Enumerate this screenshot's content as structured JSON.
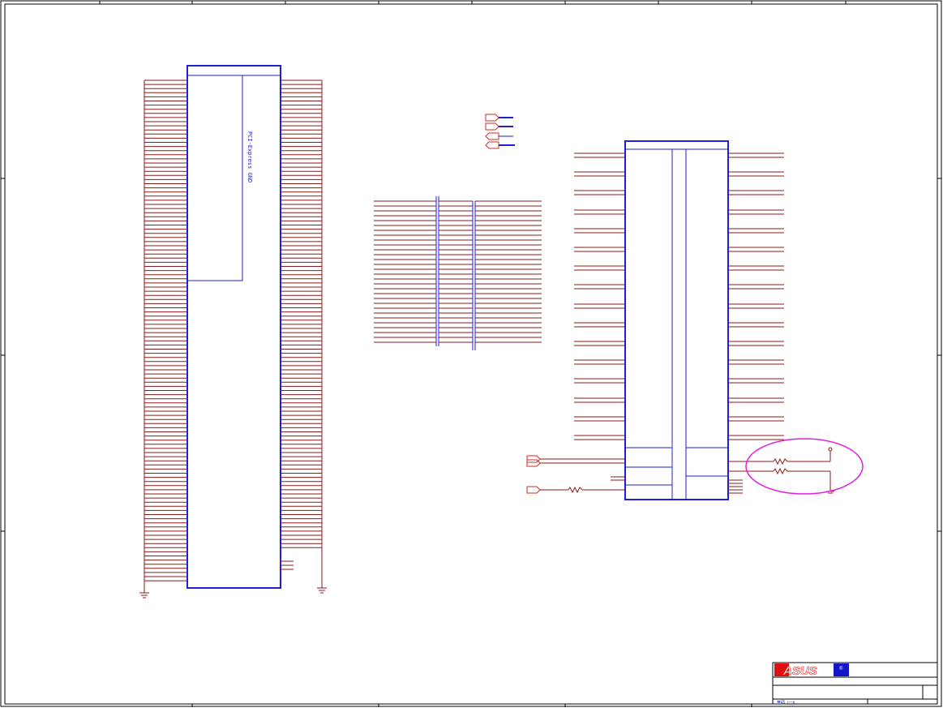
{
  "sheet": {
    "connector_label": "PCI-Express GND"
  },
  "title_block": {
    "logo_text": "ASUS",
    "registered_mark": "®",
    "footer_text": "華碩 Ⅰ一Ⅱ"
  },
  "colors": {
    "wire": "#8b1a1a",
    "part": "#1f1fd6",
    "frame": "#000000",
    "port": "#cc2b2b",
    "highlight": "#e020e0",
    "logo_red": "#e01010",
    "logo_blue": "#1414c8"
  }
}
